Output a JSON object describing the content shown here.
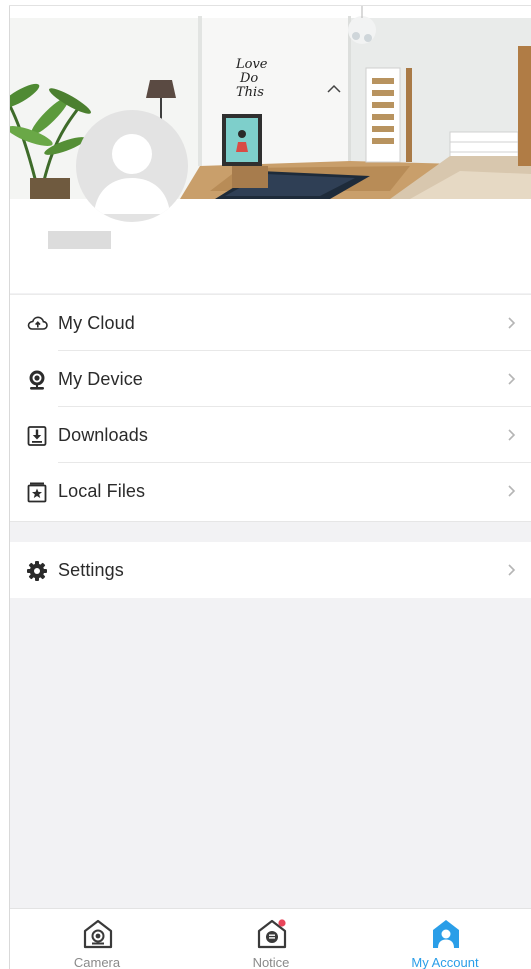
{
  "menu": {
    "items": [
      {
        "label": "My Cloud",
        "icon": "cloud-upload-icon"
      },
      {
        "label": "My Device",
        "icon": "webcam-icon"
      },
      {
        "label": "Downloads",
        "icon": "download-icon"
      },
      {
        "label": "Local Files",
        "icon": "starred-folder-icon"
      }
    ]
  },
  "settings": {
    "label": "Settings",
    "icon": "gear-icon"
  },
  "tabbar": {
    "tabs": [
      {
        "label": "Camera",
        "icon": "camera-home-icon",
        "active": false
      },
      {
        "label": "Notice",
        "icon": "notice-home-icon",
        "active": false,
        "badge": true
      },
      {
        "label": "My Account",
        "icon": "account-home-icon",
        "active": true
      }
    ]
  },
  "colors": {
    "accent": "#2a9ee8",
    "badge": "#e8455a",
    "background": "#f2f2f4",
    "text": "#2b2b2b",
    "tab_inactive": "#8a8a8a"
  },
  "photo_art": {
    "poster_lines": [
      "Love",
      "Do",
      "This"
    ]
  }
}
